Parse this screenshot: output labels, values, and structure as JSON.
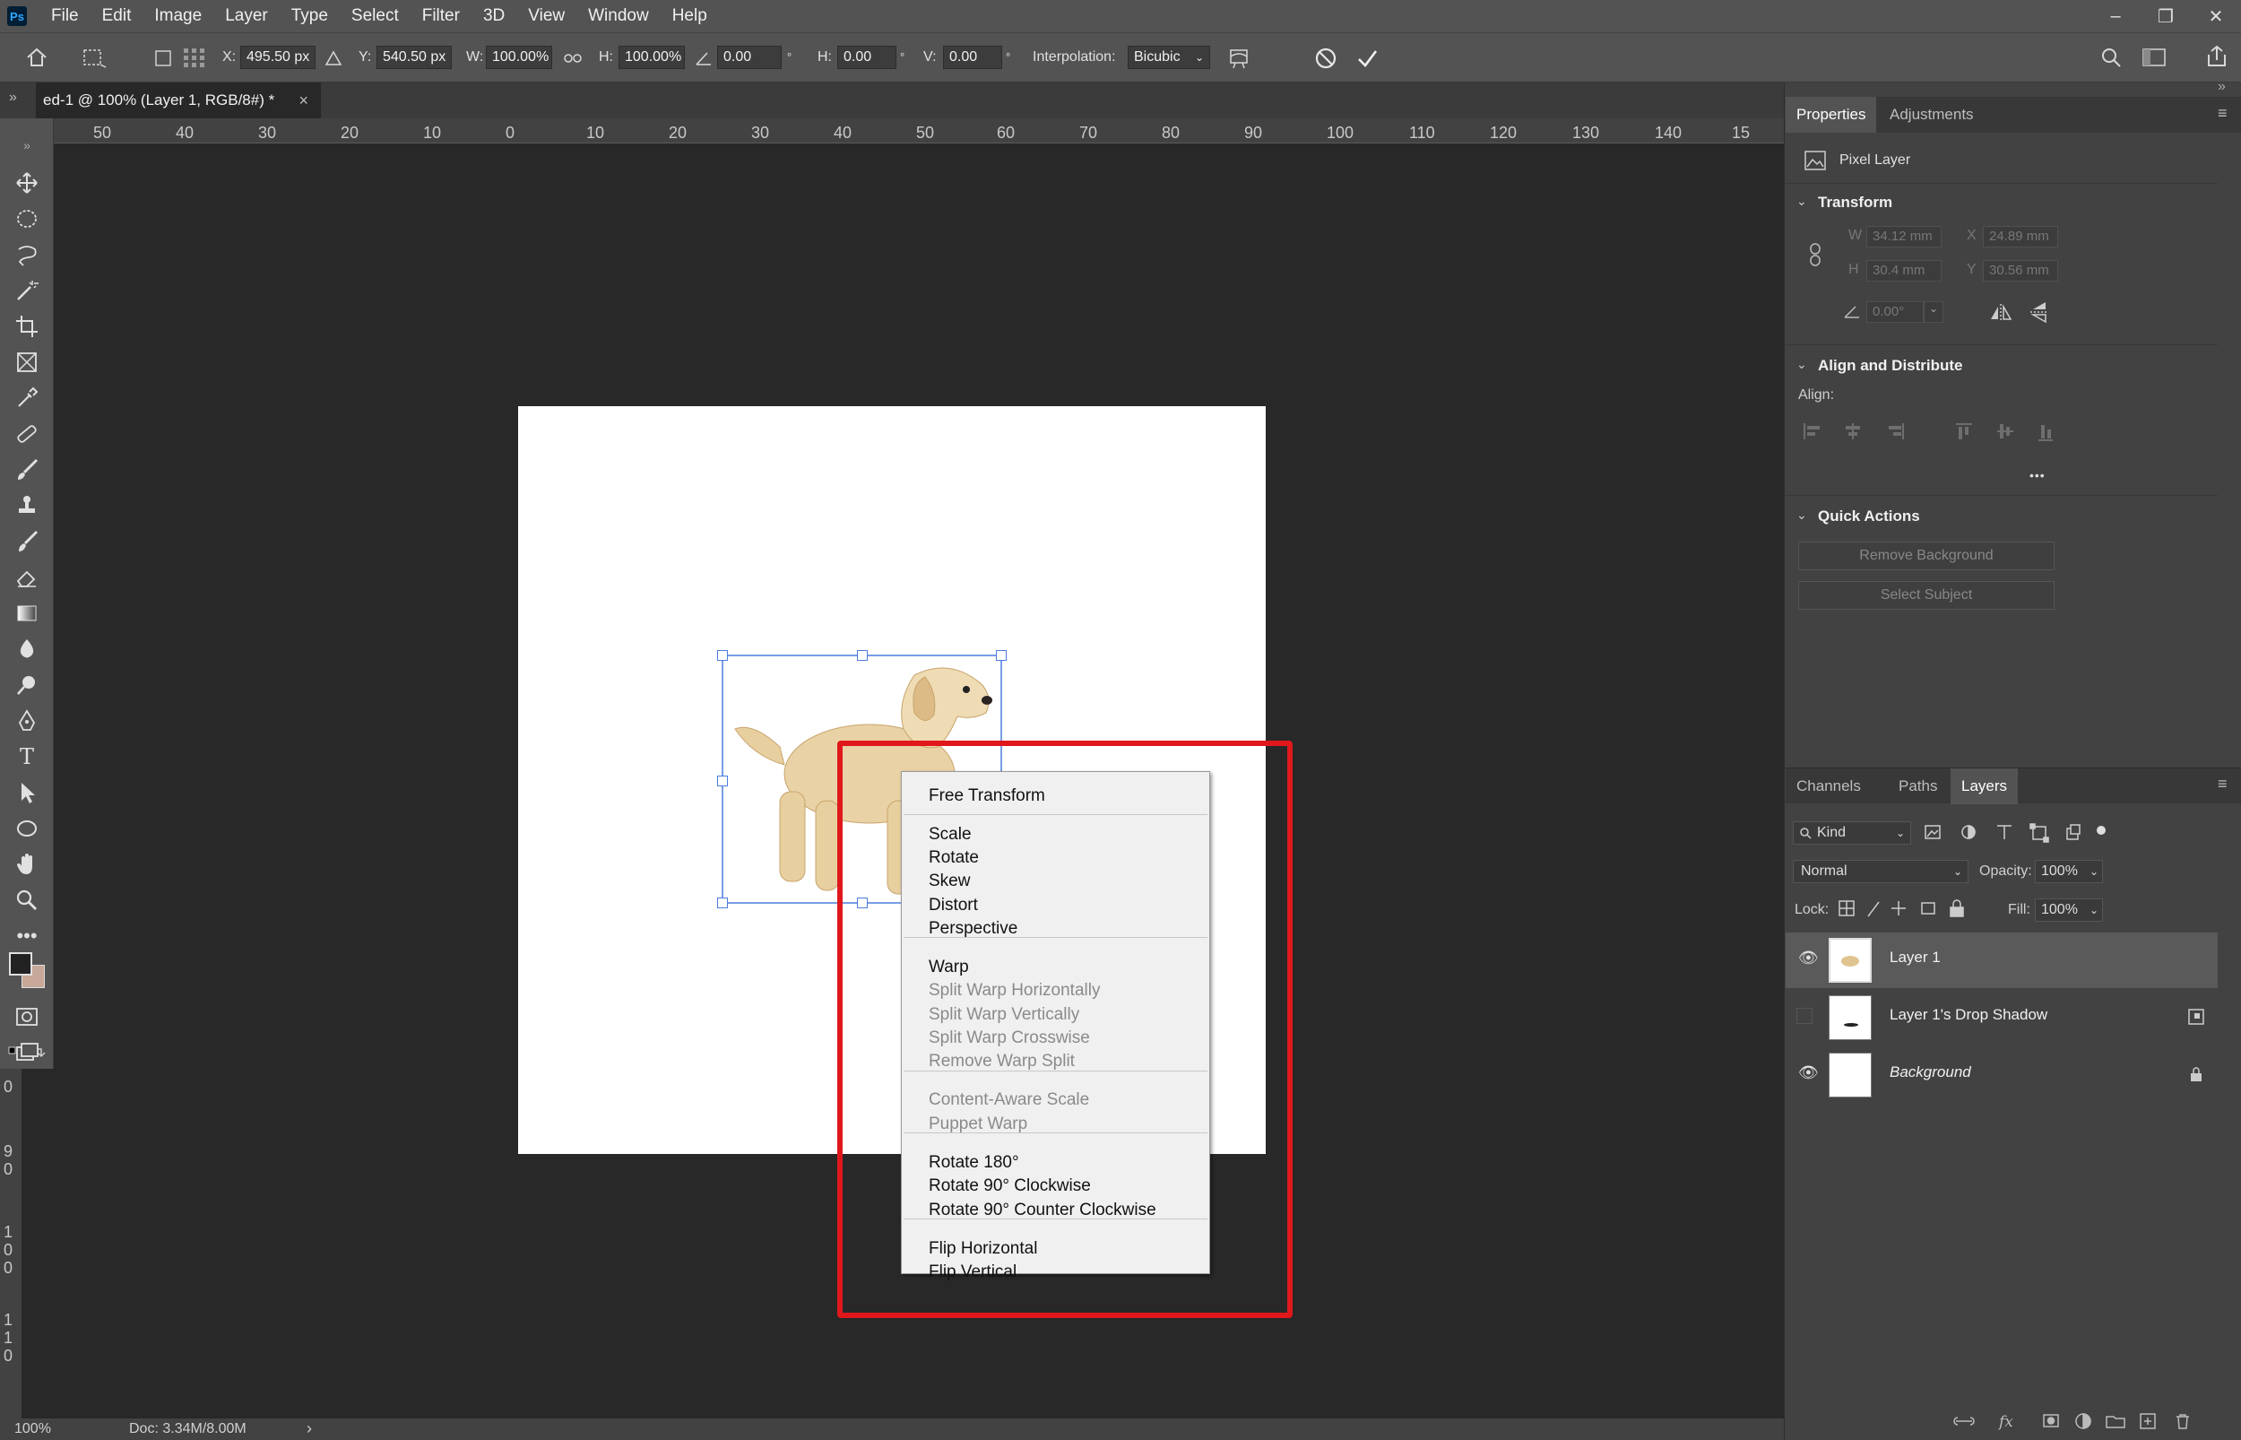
{
  "app": {
    "logo": "Ps"
  },
  "menu": [
    "File",
    "Edit",
    "Image",
    "Layer",
    "Type",
    "Select",
    "Filter",
    "3D",
    "View",
    "Window",
    "Help"
  ],
  "window_controls": {
    "minimize": "–",
    "restore": "❐",
    "close": "✕"
  },
  "options": {
    "x_label": "X:",
    "x_value": "495.50 px",
    "y_label": "Y:",
    "y_value": "540.50 px",
    "w_label": "W:",
    "w_value": "100.00%",
    "h_label": "H:",
    "h_value": "100.00%",
    "angle_value": "0.00",
    "angle_unit": "°",
    "hskew_label": "H:",
    "hskew_value": "0.00",
    "hskew_unit": "°",
    "vskew_label": "V:",
    "vskew_value": "0.00",
    "vskew_unit": "°",
    "interp_label": "Interpolation:",
    "interp_value": "Bicubic"
  },
  "document_tab": {
    "title": "ed-1 @ 100% (Layer 1, RGB/8#) *",
    "close": "×"
  },
  "ruler_ticks": [
    "50",
    "40",
    "30",
    "20",
    "10",
    "0",
    "10",
    "20",
    "30",
    "40",
    "50",
    "60",
    "70",
    "80",
    "90",
    "100",
    "110",
    "120",
    "130",
    "140",
    "15"
  ],
  "vruler_ticks": [
    "0",
    "9",
    "0",
    "1",
    "0",
    "0",
    "1",
    "1",
    "0"
  ],
  "context_menu": {
    "group1": [
      "Free Transform"
    ],
    "group2": [
      "Scale",
      "Rotate",
      "Skew",
      "Distort",
      "Perspective"
    ],
    "group3": [
      "Warp",
      "Split Warp Horizontally",
      "Split Warp Vertically",
      "Split Warp Crosswise",
      "Remove Warp Split"
    ],
    "group4": [
      "Content-Aware Scale",
      "Puppet Warp"
    ],
    "group5": [
      "Rotate 180°",
      "Rotate 90° Clockwise",
      "Rotate 90° Counter Clockwise"
    ],
    "group6": [
      "Flip Horizontal",
      "Flip Vertical"
    ]
  },
  "status": {
    "zoom": "100%",
    "doc": "Doc: 3.34M/8.00M",
    "arrow": "›"
  },
  "properties": {
    "tabs": [
      "Properties",
      "Adjustments"
    ],
    "layer_type": "Pixel Layer",
    "transform_title": "Transform",
    "w_label": "W",
    "w_value": "34.12 mm",
    "h_label": "H",
    "h_value": "30.4 mm",
    "x_label": "X",
    "x_value": "24.89 mm",
    "y_label": "Y",
    "y_value": "30.56 mm",
    "angle_value": "0.00°",
    "align_title": "Align and Distribute",
    "align_label": "Align:",
    "more": "•••",
    "quick_title": "Quick Actions",
    "remove_bg": "Remove Background",
    "select_subject": "Select Subject"
  },
  "layers_panel": {
    "tabs": [
      "Channels",
      "Paths",
      "Layers"
    ],
    "kind": "Kind",
    "blend_mode": "Normal",
    "opacity_label": "Opacity:",
    "opacity_value": "100%",
    "lock_label": "Lock:",
    "fill_label": "Fill:",
    "fill_value": "100%",
    "layers": [
      {
        "name": "Layer 1",
        "visible": true,
        "selected": true
      },
      {
        "name": "Layer 1's Drop Shadow",
        "visible": false,
        "selected": false
      },
      {
        "name": "Background",
        "visible": true,
        "selected": false
      }
    ]
  },
  "colors": {
    "accent_red": "#e0181c",
    "handle_blue": "#4b7ce0",
    "panel_bg": "#424242"
  }
}
